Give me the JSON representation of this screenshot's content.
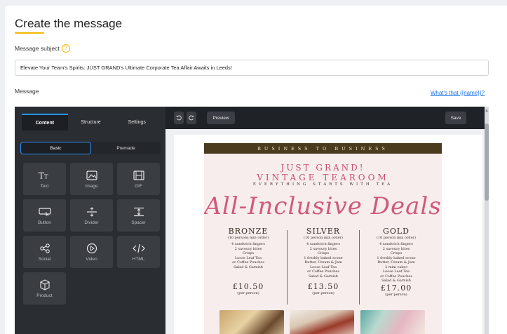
{
  "page": {
    "title": "Create the message"
  },
  "subject": {
    "label": "Message subject",
    "value": "Elevate Your Team's Spirits: JUST GRAND's Ultimate Corporate Tea Affair Awaits in Leeds!"
  },
  "message": {
    "label": "Message",
    "help_link": "What's that {{name}}?"
  },
  "editor": {
    "tabs": [
      {
        "label": "Content",
        "active": true
      },
      {
        "label": "Structure",
        "active": false
      },
      {
        "label": "Settings",
        "active": false
      }
    ],
    "segment": {
      "basic": "Basic",
      "premade": "Premade"
    },
    "tools": [
      {
        "label": "Text",
        "icon": "text-icon"
      },
      {
        "label": "Image",
        "icon": "image-icon"
      },
      {
        "label": "GIF",
        "icon": "gif-icon"
      },
      {
        "label": "Button",
        "icon": "button-icon"
      },
      {
        "label": "Divider",
        "icon": "divider-icon"
      },
      {
        "label": "Spacer",
        "icon": "spacer-icon"
      },
      {
        "label": "Social",
        "icon": "share-icon"
      },
      {
        "label": "Video",
        "icon": "video-icon"
      },
      {
        "label": "HTML",
        "icon": "code-icon"
      },
      {
        "label": "Product",
        "icon": "box-icon"
      }
    ],
    "toolbar": {
      "undo_icon": "undo-icon",
      "redo_icon": "redo-icon",
      "preview": "Preview",
      "save": "Save"
    }
  },
  "flyer": {
    "banner": "BUSINESS TO BUSINESS",
    "brand_line1": "JUST GRAND!",
    "brand_line2": "VINTAGE TEAROOM",
    "tagline": "EVERYTHING STARTS WITH TEA",
    "headline": "All-Inclusive Deals",
    "tiers": [
      {
        "name": "BRONZE",
        "note": "(10 persons min order)",
        "items": "4 sandwich fingers\n2 savoury bites\nCrisps\nLoose Leaf Tea\nor Coffee Pouches\nSalad & Garnish",
        "price": "£10.50",
        "per": "(per person)"
      },
      {
        "name": "SILVER",
        "note": "(10 person min order)",
        "items": "4 sandwich fingers\n2 savoury bites\nCrisps\n1 freshly baked scone\nButter, Cream & Jam\nLoose Leaf Tea\nor Coffee Pouches\nSalad & Garnish",
        "price": "£13.50",
        "per": "(per person)"
      },
      {
        "name": "GOLD",
        "note": "(10 person min order)",
        "items": "4 sandwich fingers\n2 savoury bites\nCrisps\n1 freshly baked scone\nButter, Cream & Jam\n2 mini cakes\nLoose Leaf Tea\nor Coffee Pouches\nSalad & Garnish",
        "price": "£17.00",
        "per": "(per person)"
      }
    ]
  },
  "colors": {
    "accent": "#f5b800",
    "link": "#1a73e8",
    "editor_bg": "#1f2226",
    "tab_highlight": "#2196f3",
    "flyer_pink": "#d05a7a"
  }
}
